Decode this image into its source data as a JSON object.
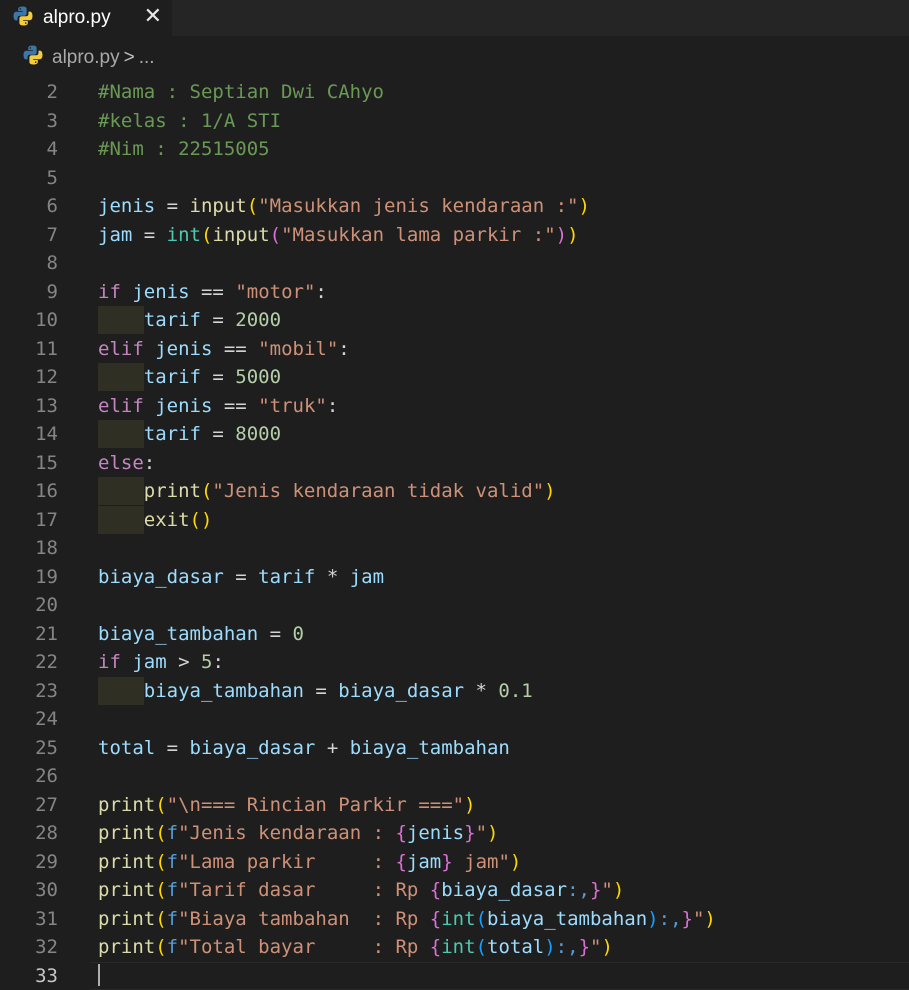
{
  "tab": {
    "label": "alpro.py",
    "close": "✕",
    "icon": "python-icon"
  },
  "breadcrumb": {
    "file": "alpro.py",
    "sep": ">",
    "rest": "..."
  },
  "active_line": 33,
  "lines": [
    {
      "n": 2,
      "indent": false,
      "tokens": [
        {
          "t": "#Nama : Septian Dwi CAhyo",
          "c": "cmt"
        }
      ]
    },
    {
      "n": 3,
      "indent": false,
      "tokens": [
        {
          "t": "#kelas : 1/A STI",
          "c": "cmt"
        }
      ]
    },
    {
      "n": 4,
      "indent": false,
      "tokens": [
        {
          "t": "#Nim : 22515005",
          "c": "cmt"
        }
      ]
    },
    {
      "n": 5,
      "indent": false,
      "tokens": []
    },
    {
      "n": 6,
      "indent": false,
      "tokens": [
        {
          "t": "jenis",
          "c": "var"
        },
        {
          "t": " = ",
          "c": "op"
        },
        {
          "t": "input",
          "c": "fn"
        },
        {
          "t": "(",
          "c": "brk1"
        },
        {
          "t": "\"Masukkan jenis kendaraan :\"",
          "c": "str"
        },
        {
          "t": ")",
          "c": "brk1"
        }
      ]
    },
    {
      "n": 7,
      "indent": false,
      "tokens": [
        {
          "t": "jam",
          "c": "var"
        },
        {
          "t": " = ",
          "c": "op"
        },
        {
          "t": "int",
          "c": "typ"
        },
        {
          "t": "(",
          "c": "brk1"
        },
        {
          "t": "input",
          "c": "fn"
        },
        {
          "t": "(",
          "c": "brk2"
        },
        {
          "t": "\"Masukkan lama parkir :\"",
          "c": "str"
        },
        {
          "t": ")",
          "c": "brk2"
        },
        {
          "t": ")",
          "c": "brk1"
        }
      ]
    },
    {
      "n": 8,
      "indent": false,
      "tokens": []
    },
    {
      "n": 9,
      "indent": false,
      "tokens": [
        {
          "t": "if",
          "c": "kw"
        },
        {
          "t": " ",
          "c": "op"
        },
        {
          "t": "jenis",
          "c": "var"
        },
        {
          "t": " == ",
          "c": "op"
        },
        {
          "t": "\"motor\"",
          "c": "str"
        },
        {
          "t": ":",
          "c": "op"
        }
      ]
    },
    {
      "n": 10,
      "indent": true,
      "tokens": [
        {
          "t": "    ",
          "c": "op"
        },
        {
          "t": "tarif",
          "c": "var"
        },
        {
          "t": " = ",
          "c": "op"
        },
        {
          "t": "2000",
          "c": "num"
        }
      ]
    },
    {
      "n": 11,
      "indent": false,
      "tokens": [
        {
          "t": "elif",
          "c": "kw"
        },
        {
          "t": " ",
          "c": "op"
        },
        {
          "t": "jenis",
          "c": "var"
        },
        {
          "t": " == ",
          "c": "op"
        },
        {
          "t": "\"mobil\"",
          "c": "str"
        },
        {
          "t": ":",
          "c": "op"
        }
      ]
    },
    {
      "n": 12,
      "indent": true,
      "tokens": [
        {
          "t": "    ",
          "c": "op"
        },
        {
          "t": "tarif",
          "c": "var"
        },
        {
          "t": " = ",
          "c": "op"
        },
        {
          "t": "5000",
          "c": "num"
        }
      ]
    },
    {
      "n": 13,
      "indent": false,
      "tokens": [
        {
          "t": "elif",
          "c": "kw"
        },
        {
          "t": " ",
          "c": "op"
        },
        {
          "t": "jenis",
          "c": "var"
        },
        {
          "t": " == ",
          "c": "op"
        },
        {
          "t": "\"truk\"",
          "c": "str"
        },
        {
          "t": ":",
          "c": "op"
        }
      ]
    },
    {
      "n": 14,
      "indent": true,
      "tokens": [
        {
          "t": "    ",
          "c": "op"
        },
        {
          "t": "tarif",
          "c": "var"
        },
        {
          "t": " = ",
          "c": "op"
        },
        {
          "t": "8000",
          "c": "num"
        }
      ]
    },
    {
      "n": 15,
      "indent": false,
      "tokens": [
        {
          "t": "else",
          "c": "kw"
        },
        {
          "t": ":",
          "c": "op"
        }
      ]
    },
    {
      "n": 16,
      "indent": true,
      "tokens": [
        {
          "t": "    ",
          "c": "op"
        },
        {
          "t": "print",
          "c": "fn"
        },
        {
          "t": "(",
          "c": "brk1"
        },
        {
          "t": "\"Jenis kendaraan tidak valid\"",
          "c": "str"
        },
        {
          "t": ")",
          "c": "brk1"
        }
      ]
    },
    {
      "n": 17,
      "indent": true,
      "tokens": [
        {
          "t": "    ",
          "c": "op"
        },
        {
          "t": "exit",
          "c": "fn"
        },
        {
          "t": "()",
          "c": "brk1"
        }
      ]
    },
    {
      "n": 18,
      "indent": false,
      "tokens": []
    },
    {
      "n": 19,
      "indent": false,
      "tokens": [
        {
          "t": "biaya_dasar",
          "c": "var"
        },
        {
          "t": " = ",
          "c": "op"
        },
        {
          "t": "tarif",
          "c": "var"
        },
        {
          "t": " * ",
          "c": "op"
        },
        {
          "t": "jam",
          "c": "var"
        }
      ]
    },
    {
      "n": 20,
      "indent": false,
      "tokens": []
    },
    {
      "n": 21,
      "indent": false,
      "tokens": [
        {
          "t": "biaya_tambahan",
          "c": "var"
        },
        {
          "t": " = ",
          "c": "op"
        },
        {
          "t": "0",
          "c": "num"
        }
      ]
    },
    {
      "n": 22,
      "indent": false,
      "tokens": [
        {
          "t": "if",
          "c": "kw"
        },
        {
          "t": " ",
          "c": "op"
        },
        {
          "t": "jam",
          "c": "var"
        },
        {
          "t": " > ",
          "c": "op"
        },
        {
          "t": "5",
          "c": "num"
        },
        {
          "t": ":",
          "c": "op"
        }
      ]
    },
    {
      "n": 23,
      "indent": true,
      "tokens": [
        {
          "t": "    ",
          "c": "op"
        },
        {
          "t": "biaya_tambahan",
          "c": "var"
        },
        {
          "t": " = ",
          "c": "op"
        },
        {
          "t": "biaya_dasar",
          "c": "var"
        },
        {
          "t": " * ",
          "c": "op"
        },
        {
          "t": "0.1",
          "c": "num"
        }
      ]
    },
    {
      "n": 24,
      "indent": false,
      "tokens": []
    },
    {
      "n": 25,
      "indent": false,
      "tokens": [
        {
          "t": "total",
          "c": "var"
        },
        {
          "t": " = ",
          "c": "op"
        },
        {
          "t": "biaya_dasar",
          "c": "var"
        },
        {
          "t": " + ",
          "c": "op"
        },
        {
          "t": "biaya_tambahan",
          "c": "var"
        }
      ]
    },
    {
      "n": 26,
      "indent": false,
      "tokens": []
    },
    {
      "n": 27,
      "indent": false,
      "tokens": [
        {
          "t": "print",
          "c": "fn"
        },
        {
          "t": "(",
          "c": "brk1"
        },
        {
          "t": "\"\\n=== Rincian Parkir ===\"",
          "c": "str"
        },
        {
          "t": ")",
          "c": "brk1"
        }
      ]
    },
    {
      "n": 28,
      "indent": false,
      "tokens": [
        {
          "t": "print",
          "c": "fn"
        },
        {
          "t": "(",
          "c": "brk1"
        },
        {
          "t": "f",
          "c": "fpre"
        },
        {
          "t": "\"Jenis kendaraan : ",
          "c": "str"
        },
        {
          "t": "{",
          "c": "brk2"
        },
        {
          "t": "jenis",
          "c": "var"
        },
        {
          "t": "}",
          "c": "brk2"
        },
        {
          "t": "\"",
          "c": "str"
        },
        {
          "t": ")",
          "c": "brk1"
        }
      ]
    },
    {
      "n": 29,
      "indent": false,
      "tokens": [
        {
          "t": "print",
          "c": "fn"
        },
        {
          "t": "(",
          "c": "brk1"
        },
        {
          "t": "f",
          "c": "fpre"
        },
        {
          "t": "\"Lama parkir     : ",
          "c": "str"
        },
        {
          "t": "{",
          "c": "brk2"
        },
        {
          "t": "jam",
          "c": "var"
        },
        {
          "t": "}",
          "c": "brk2"
        },
        {
          "t": " jam\"",
          "c": "str"
        },
        {
          "t": ")",
          "c": "brk1"
        }
      ]
    },
    {
      "n": 30,
      "indent": false,
      "tokens": [
        {
          "t": "print",
          "c": "fn"
        },
        {
          "t": "(",
          "c": "brk1"
        },
        {
          "t": "f",
          "c": "fpre"
        },
        {
          "t": "\"Tarif dasar     : Rp ",
          "c": "str"
        },
        {
          "t": "{",
          "c": "brk2"
        },
        {
          "t": "biaya_dasar",
          "c": "var"
        },
        {
          "t": ":,",
          "c": "fpre"
        },
        {
          "t": "}",
          "c": "brk2"
        },
        {
          "t": "\"",
          "c": "str"
        },
        {
          "t": ")",
          "c": "brk1"
        }
      ]
    },
    {
      "n": 31,
      "indent": false,
      "tokens": [
        {
          "t": "print",
          "c": "fn"
        },
        {
          "t": "(",
          "c": "brk1"
        },
        {
          "t": "f",
          "c": "fpre"
        },
        {
          "t": "\"Biaya tambahan  : Rp ",
          "c": "str"
        },
        {
          "t": "{",
          "c": "brk2"
        },
        {
          "t": "int",
          "c": "typ"
        },
        {
          "t": "(",
          "c": "brk3"
        },
        {
          "t": "biaya_tambahan",
          "c": "var"
        },
        {
          "t": ")",
          "c": "brk3"
        },
        {
          "t": ":,",
          "c": "fpre"
        },
        {
          "t": "}",
          "c": "brk2"
        },
        {
          "t": "\"",
          "c": "str"
        },
        {
          "t": ")",
          "c": "brk1"
        }
      ]
    },
    {
      "n": 32,
      "indent": false,
      "tokens": [
        {
          "t": "print",
          "c": "fn"
        },
        {
          "t": "(",
          "c": "brk1"
        },
        {
          "t": "f",
          "c": "fpre"
        },
        {
          "t": "\"Total bayar     : Rp ",
          "c": "str"
        },
        {
          "t": "{",
          "c": "brk2"
        },
        {
          "t": "int",
          "c": "typ"
        },
        {
          "t": "(",
          "c": "brk3"
        },
        {
          "t": "total",
          "c": "var"
        },
        {
          "t": ")",
          "c": "brk3"
        },
        {
          "t": ":,",
          "c": "fpre"
        },
        {
          "t": "}",
          "c": "brk2"
        },
        {
          "t": "\"",
          "c": "str"
        },
        {
          "t": ")",
          "c": "brk1"
        }
      ]
    },
    {
      "n": 33,
      "indent": false,
      "tokens": []
    }
  ]
}
